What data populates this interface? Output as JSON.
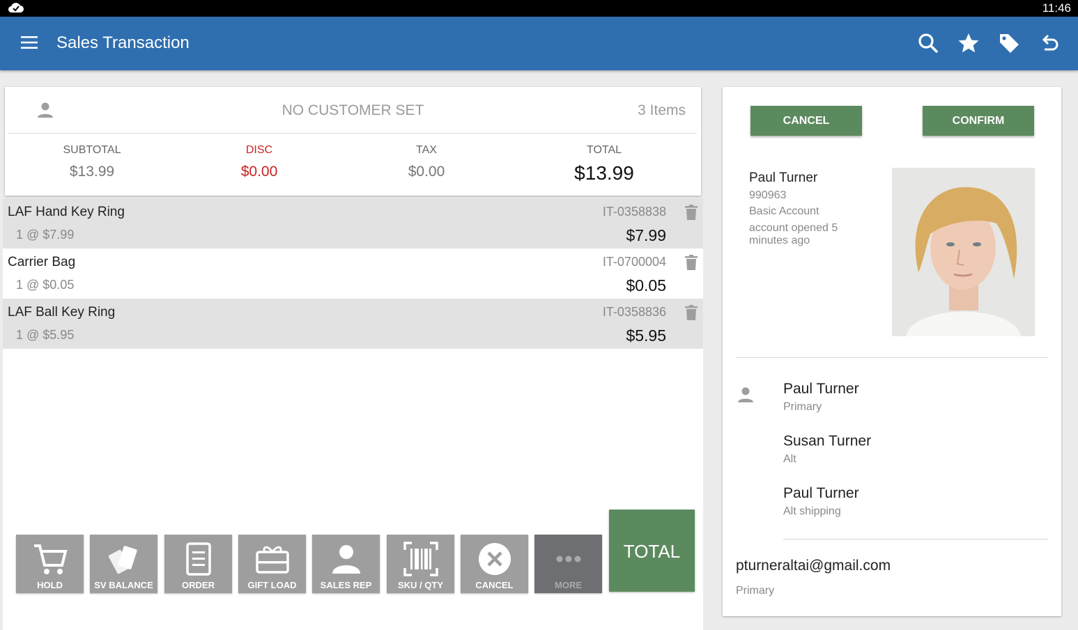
{
  "status": {
    "time": "11:46"
  },
  "appbar": {
    "title": "Sales Transaction",
    "actions": [
      "search-icon",
      "star-icon",
      "tag-icon",
      "undo-icon"
    ],
    "color": "#2f6fb0"
  },
  "summary": {
    "customer": "NO CUSTOMER SET",
    "items_count": "3 Items",
    "subtotal_label": "SUBTOTAL",
    "subtotal": "$13.99",
    "disc_label": "DISC",
    "disc": "$0.00",
    "tax_label": "TAX",
    "tax": "$0.00",
    "total_label": "TOTAL",
    "total": "$13.99"
  },
  "lines": [
    {
      "name": "LAF Hand Key Ring",
      "qty": "1 @ $7.99",
      "sku": "IT-0358838",
      "price": "$7.99"
    },
    {
      "name": "Carrier Bag",
      "qty": "1 @ $0.05",
      "sku": "IT-0700004",
      "price": "$0.05"
    },
    {
      "name": "LAF Ball Key Ring",
      "qty": "1 @ $5.95",
      "sku": "IT-0358836",
      "price": "$5.95"
    }
  ],
  "toolbar": {
    "hold": "HOLD",
    "sv_balance": "SV BALANCE",
    "order": "ORDER",
    "gift_load": "GIFT LOAD",
    "sales_rep": "SALES REP",
    "sku_qty": "SKU / QTY",
    "cancel": "CANCEL",
    "more": "MORE",
    "total": "TOTAL"
  },
  "panel": {
    "cancel": "CANCEL",
    "confirm": "CONFIRM",
    "profile": {
      "name": "Paul Turner",
      "id": "990963",
      "account_type": "Basic Account",
      "opened": "account opened 5 minutes ago"
    },
    "contacts": [
      {
        "name": "Paul Turner",
        "role": "Primary"
      },
      {
        "name": "Susan Turner",
        "role": "Alt"
      },
      {
        "name": "Paul Turner",
        "role": "Alt shipping"
      }
    ],
    "email": "pturneraltai@gmail.com",
    "email_role": "Primary"
  },
  "colors": {
    "accent_green": "#5c8a5f",
    "disc_red": "#cc2222",
    "button_gray": "#9e9e9e"
  }
}
